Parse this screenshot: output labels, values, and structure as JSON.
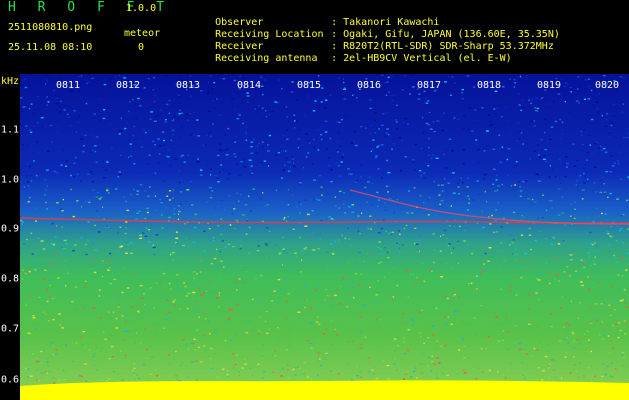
{
  "app": {
    "brand": "H R O F F T",
    "version": "1.0.0"
  },
  "capture": {
    "filename": "2511080810.png",
    "timestamp": "25.11.08 08:10",
    "meteor_label": "meteor",
    "meteor_count": "0"
  },
  "info": [
    {
      "label": "Observer",
      "value": "Takanori Kawachi"
    },
    {
      "label": "Receiving Location",
      "value": "Ogaki, Gifu, JAPAN (136.60E, 35.35N)"
    },
    {
      "label": "Receiver",
      "value": "R820T2(RTL-SDR) SDR-Sharp 53.372MHz"
    },
    {
      "label": "Receiving antenna",
      "value": "2el-HB9CV Vertical (el. E-W)"
    }
  ],
  "axis": {
    "unit": "kHz",
    "y_labels": [
      "1.1",
      "1.0",
      "0.9",
      "0.8",
      "0.7",
      "0.6"
    ],
    "time_labels": [
      "0811",
      "0812",
      "0813",
      "0814",
      "0815",
      "0816",
      "0817",
      "0818",
      "0819",
      "0820"
    ]
  },
  "colors": {
    "brand": "#22e24a",
    "text": "#ffff33",
    "tick": "#ffffff",
    "noise_band": "#ffff00",
    "trace": "#ff3344"
  }
}
